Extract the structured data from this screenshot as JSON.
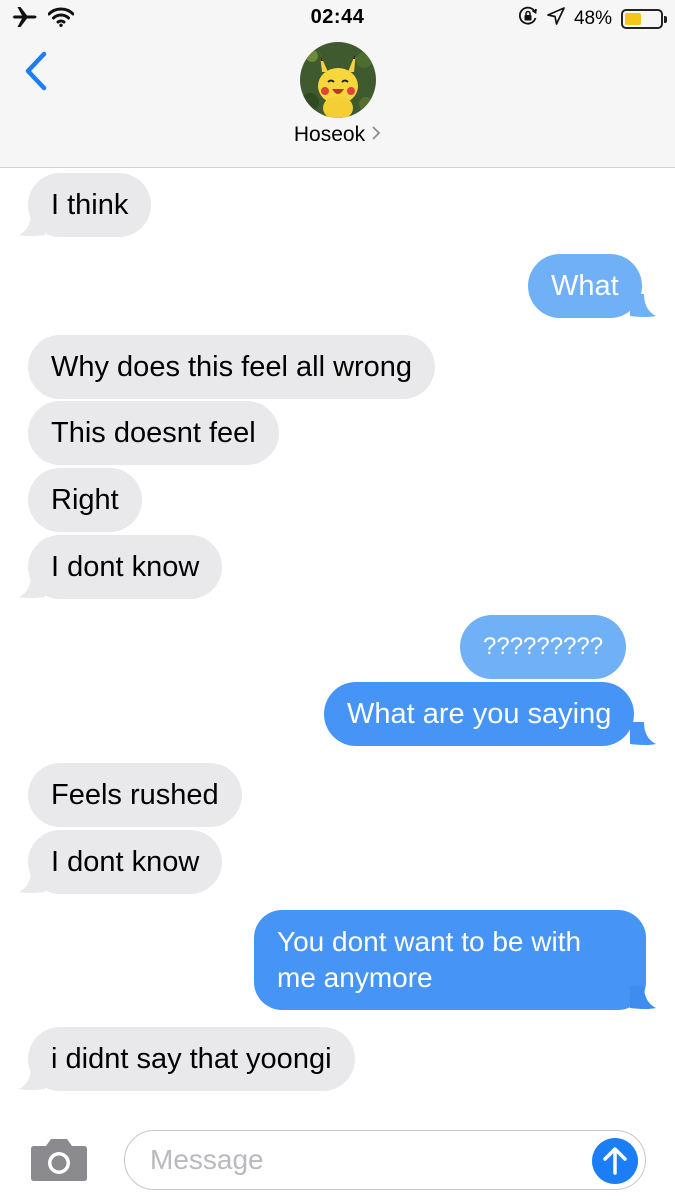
{
  "status_bar": {
    "time": "02:44",
    "battery_percent": "48%",
    "battery_level": 0.48,
    "icons": [
      "airplane-icon",
      "wifi-icon",
      "orientation-lock-icon",
      "location-arrow-icon",
      "battery-icon"
    ]
  },
  "header": {
    "contact_name": "Hoseok",
    "back_icon": "chevron-left-icon",
    "avatar": "pikachu-avatar"
  },
  "colors": {
    "incoming_bubble": "#e9e9eb",
    "outgoing_bubble": "#4695f6",
    "outgoing_bubble_light": "#6fb0f6",
    "accent": "#1b7ef6",
    "battery": "#f5c518"
  },
  "messages": [
    {
      "direction": "in",
      "text": "I think"
    },
    {
      "direction": "out",
      "text": "What"
    },
    {
      "direction": "in",
      "text": "Why does this feel all wrong"
    },
    {
      "direction": "in",
      "text": "This doesnt feel"
    },
    {
      "direction": "in",
      "text": "Right"
    },
    {
      "direction": "in",
      "text": "I dont know"
    },
    {
      "direction": "out",
      "text": "?????????"
    },
    {
      "direction": "out",
      "text": "What are you saying"
    },
    {
      "direction": "in",
      "text": "Feels rushed"
    },
    {
      "direction": "in",
      "text": "I dont know"
    },
    {
      "direction": "out",
      "text": "You dont want to be with me anymore"
    },
    {
      "direction": "in",
      "text": "i didnt say that yoongi"
    }
  ],
  "composer": {
    "placeholder": "Message",
    "camera_icon": "camera-icon",
    "send_icon": "arrow-up-icon"
  }
}
